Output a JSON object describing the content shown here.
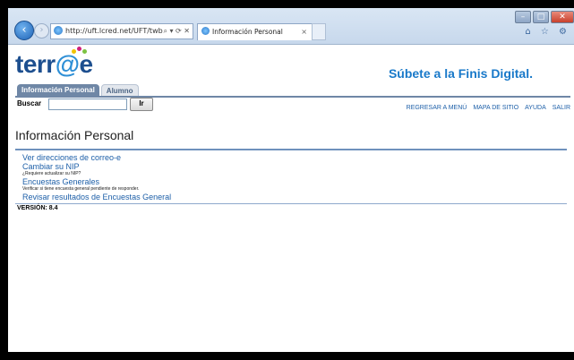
{
  "browser": {
    "address": "http://uft.lcred.net/UFT/twb",
    "tab_title": "Información Personal",
    "tab_close": "×",
    "addr_tools": "⌕ ▾ ⟳ ✕",
    "min": "–",
    "max": "□",
    "close": "✕",
    "right_icons": "⌂ ☆ ⚙"
  },
  "site": {
    "logo_pre": "terr",
    "logo_at": "@",
    "logo_post": "e",
    "tagline": "Súbete a la Finis Digital.",
    "tabs": [
      "Información Personal",
      "Alumno"
    ],
    "search_label": "Buscar",
    "search_button": "Ir",
    "links": [
      "REGRESAR A MENÚ",
      "MAPA DE SITIO",
      "AYUDA",
      "SALIR"
    ]
  },
  "main": {
    "title": "Información Personal",
    "items": [
      {
        "label": "Ver direcciones de correo-e",
        "desc": ""
      },
      {
        "label": "Cambiar su NIP",
        "desc": "¿Requiere actualizar su NIP?"
      },
      {
        "label": "Encuestas Generales",
        "desc": "Verificar si tiene encuesta general pendiente de responder."
      },
      {
        "label": "Revisar resultados de Encuestas General",
        "desc": ""
      }
    ],
    "version": "VERSIÓN: 8.4"
  },
  "colors": {
    "logo_dot1": "#f2c300",
    "logo_dot2": "#d0217b",
    "logo_dot3": "#7cc242"
  }
}
